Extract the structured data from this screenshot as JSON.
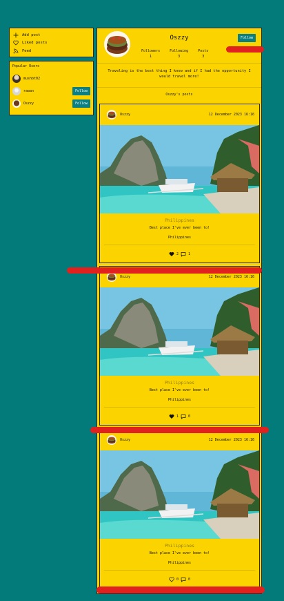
{
  "menu": {
    "items": [
      {
        "label": "Add post",
        "icon": "plus-icon"
      },
      {
        "label": "Liked posts",
        "icon": "heart-outline-icon"
      },
      {
        "label": "Feed",
        "icon": "rss-icon"
      }
    ]
  },
  "popular": {
    "title": "Popular Users",
    "users": [
      {
        "name": "mushbt02",
        "follow": ""
      },
      {
        "name": "rawan",
        "follow": "Follow"
      },
      {
        "name": "Oszzy",
        "follow": "Follow"
      }
    ]
  },
  "profile": {
    "username": "Oszzy",
    "follow_label": "Follow",
    "followers_label": "Followers",
    "followers": "1",
    "following_label": "Following",
    "following": "3",
    "posts_label": "Posts",
    "posts": "3",
    "bio": "Traveling is the best thing I know and if I had the opportunity I would travel more!",
    "posts_heading": "Oszzy's posts"
  },
  "posts": [
    {
      "author": "Oszzy",
      "date": "12 December 2023 16:16",
      "location": "Philippines",
      "description": "Best place I've ever been to!",
      "tag": "Philippines",
      "likes": "2",
      "comments": "1",
      "liked": true
    },
    {
      "author": "Oszzy",
      "date": "12 December 2023 16:16",
      "location": "Philippines",
      "description": "Best place I've ever been to!",
      "tag": "Philippines",
      "likes": "1",
      "comments": "0",
      "liked": true
    },
    {
      "author": "Oszzy",
      "date": "12 December 2023 16:16",
      "location": "Philippines",
      "description": "Best place I've ever been to!",
      "tag": "Philippines",
      "likes": "0",
      "comments": "0",
      "liked": false
    }
  ],
  "colors": {
    "background": "#047b7b",
    "panel": "#fbd400",
    "button": "#0c7f82",
    "annotation": "#e0211d"
  }
}
